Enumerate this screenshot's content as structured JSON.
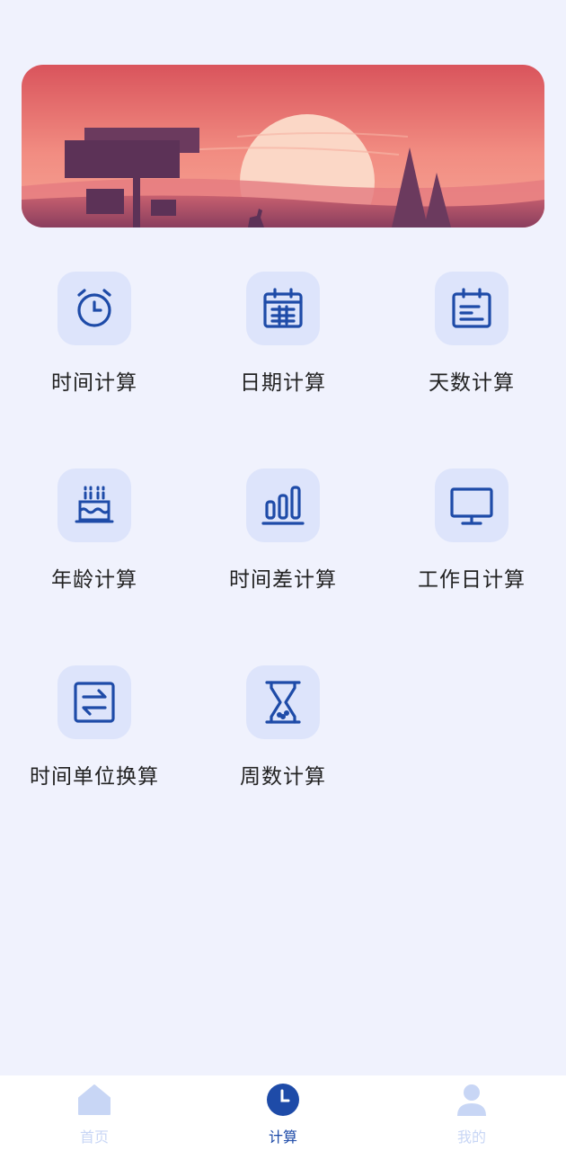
{
  "features": [
    {
      "label": "时间计算",
      "icon": "alarm-clock-icon"
    },
    {
      "label": "日期计算",
      "icon": "calendar-grid-icon"
    },
    {
      "label": "天数计算",
      "icon": "calendar-lines-icon"
    },
    {
      "label": "年龄计算",
      "icon": "birthday-cake-icon"
    },
    {
      "label": "时间差计算",
      "icon": "bar-chart-icon"
    },
    {
      "label": "工作日计算",
      "icon": "monitor-icon"
    },
    {
      "label": "时间单位换算",
      "icon": "swap-arrows-icon"
    },
    {
      "label": "周数计算",
      "icon": "hourglass-icon"
    }
  ],
  "tabs": [
    {
      "label": "首页",
      "icon": "home-icon",
      "active": false
    },
    {
      "label": "计算",
      "icon": "clock-icon",
      "active": true
    },
    {
      "label": "我的",
      "icon": "user-icon",
      "active": false
    }
  ],
  "colors": {
    "background": "#f0f2fd",
    "icon_tile": "#dde4fb",
    "icon_stroke": "#1e4ba8",
    "tab_active": "#1e4ba8",
    "tab_inactive": "#c8d6f5"
  }
}
